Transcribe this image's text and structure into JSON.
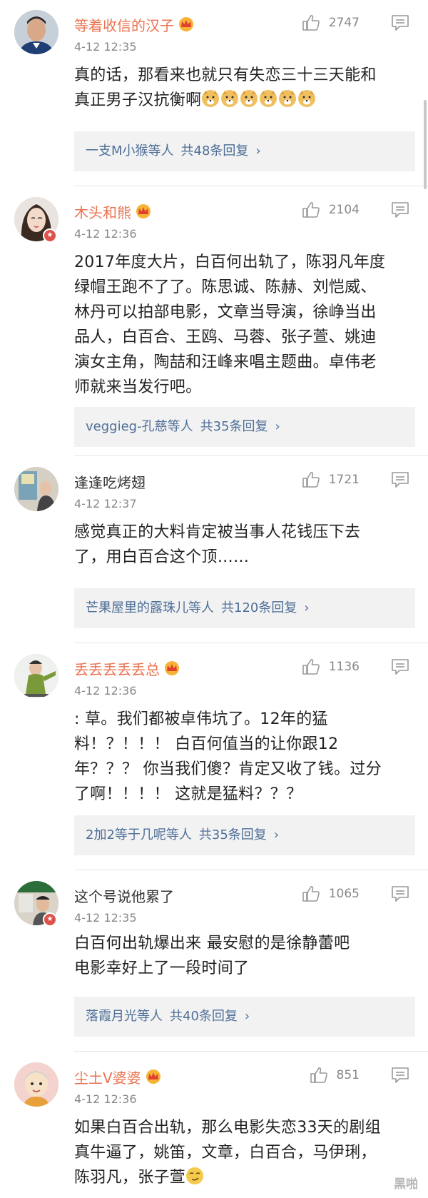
{
  "comments": [
    {
      "name": "等着收信的汉子",
      "time": "4-12 12:35",
      "likes": "2747",
      "lines": [
        "真的话，那看来也就只有失恋三十三天能和",
        "真正男子汉抗衡啊"
      ],
      "reply_users": "一支M小猴等人",
      "reply_count": "共48条回复",
      "reply_chevron": "›"
    },
    {
      "name": "木头和熊",
      "time": "4-12 12:36",
      "likes": "2104",
      "lines": [
        "2017年度大片，白百何出轨了，陈羽凡年度",
        "绿帽王跑不了了。陈思诚、陈赫、刘恺威、",
        "林丹可以拍部电影，文章当导演，徐峥当出",
        "品人，白百合、王鸥、马蓉、张子萱、姚迪",
        "演女主角，陶喆和汪峰来唱主题曲。卓伟老",
        "师就来当发行吧。"
      ],
      "reply_users": "veggieg-孔慈等人",
      "reply_count": "共35条回复",
      "reply_chevron": "›"
    },
    {
      "name": "逢逢吃烤翅",
      "time": "4-12 12:37",
      "likes": "1721",
      "lines": [
        "感觉真正的大料肯定被当事人花钱压下去",
        "了，用白百合这个顶……"
      ],
      "reply_users": "芒果屋里的露珠儿等人",
      "reply_count": "共120条回复",
      "reply_chevron": "›"
    },
    {
      "name": "丢丢丢丢丢总",
      "time": "4-12 12:36",
      "likes": "1136",
      "lines": [
        ": 草。我们都被卓伟坑了。12年的猛",
        "料！？！！！ 白百何值当的让你跟12",
        "年？？？ 你当我们傻？肯定又收了钱。过分",
        "了啊！！！！ 这就是猛料？？？"
      ],
      "reply_users": "2加2等于几呢等人",
      "reply_count": "共35条回复",
      "reply_chevron": "›"
    },
    {
      "name": "这个号说他累了",
      "time": "4-12 12:35",
      "likes": "1065",
      "lines": [
        "白百何出轨爆出来  最安慰的是徐静蕾吧",
        "电影幸好上了一段时间了"
      ],
      "reply_users": "落霞月光等人",
      "reply_count": "共40条回复",
      "reply_chevron": "›"
    },
    {
      "name": "尘土V婆婆",
      "time": "4-12 12:36",
      "likes": "851",
      "lines": [
        "如果白百合出轨，那么电影失恋33天的剧组",
        "真牛逼了，姚笛，文章，白百合，马伊琍，",
        "陈羽凡，张子萱"
      ]
    }
  ],
  "watermark": "黑啪",
  "colors": {
    "vip_name": "#eb7350",
    "link": "#4e6f97",
    "reply_bg": "#f2f2f2"
  }
}
